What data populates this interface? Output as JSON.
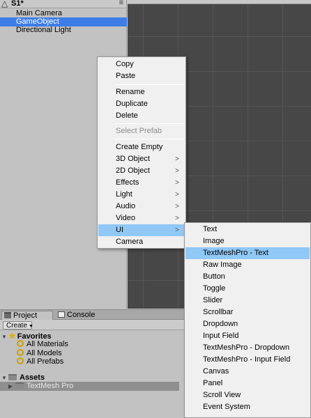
{
  "hierarchy": {
    "scene_name": "S1*",
    "scene_icon": "unity-scene-icon",
    "menu_icon": "triangle-menu-icon",
    "items": [
      {
        "label": "Main Camera",
        "selected": false
      },
      {
        "label": "GameObject",
        "selected": true
      },
      {
        "label": "Directional Light",
        "selected": false
      }
    ]
  },
  "context_menu": {
    "items": [
      "Copy",
      "Paste",
      "Rename",
      "Duplicate",
      "Delete",
      "Select Prefab",
      "Create Empty",
      "3D Object",
      "2D Object",
      "Effects",
      "Light",
      "Audio",
      "Video",
      "UI",
      "Camera"
    ],
    "disabled": "Select Prefab",
    "highlighted": "UI",
    "arrow_glyph": ">"
  },
  "ui_submenu": {
    "items": [
      "Text",
      "Image",
      "TextMeshPro - Text",
      "Raw Image",
      "Button",
      "Toggle",
      "Slider",
      "Scrollbar",
      "Dropdown",
      "Input Field",
      "TextMeshPro - Dropdown",
      "TextMeshPro - Input Field",
      "Canvas",
      "Panel",
      "Scroll View",
      "Event System"
    ],
    "highlighted": "TextMeshPro - Text"
  },
  "bottom_panel": {
    "tabs": [
      "Project",
      "Console"
    ],
    "create_label": "Create",
    "favorites_label": "Favorites",
    "favorites": [
      "All Materials",
      "All Models",
      "All Prefabs"
    ],
    "assets_label": "Assets",
    "asset_folders": [
      "TextMesh Pro"
    ]
  },
  "colors": {
    "selection": "#3e7de7",
    "menu_highlight": "#90c8f6",
    "scene_bg": "#474747"
  }
}
